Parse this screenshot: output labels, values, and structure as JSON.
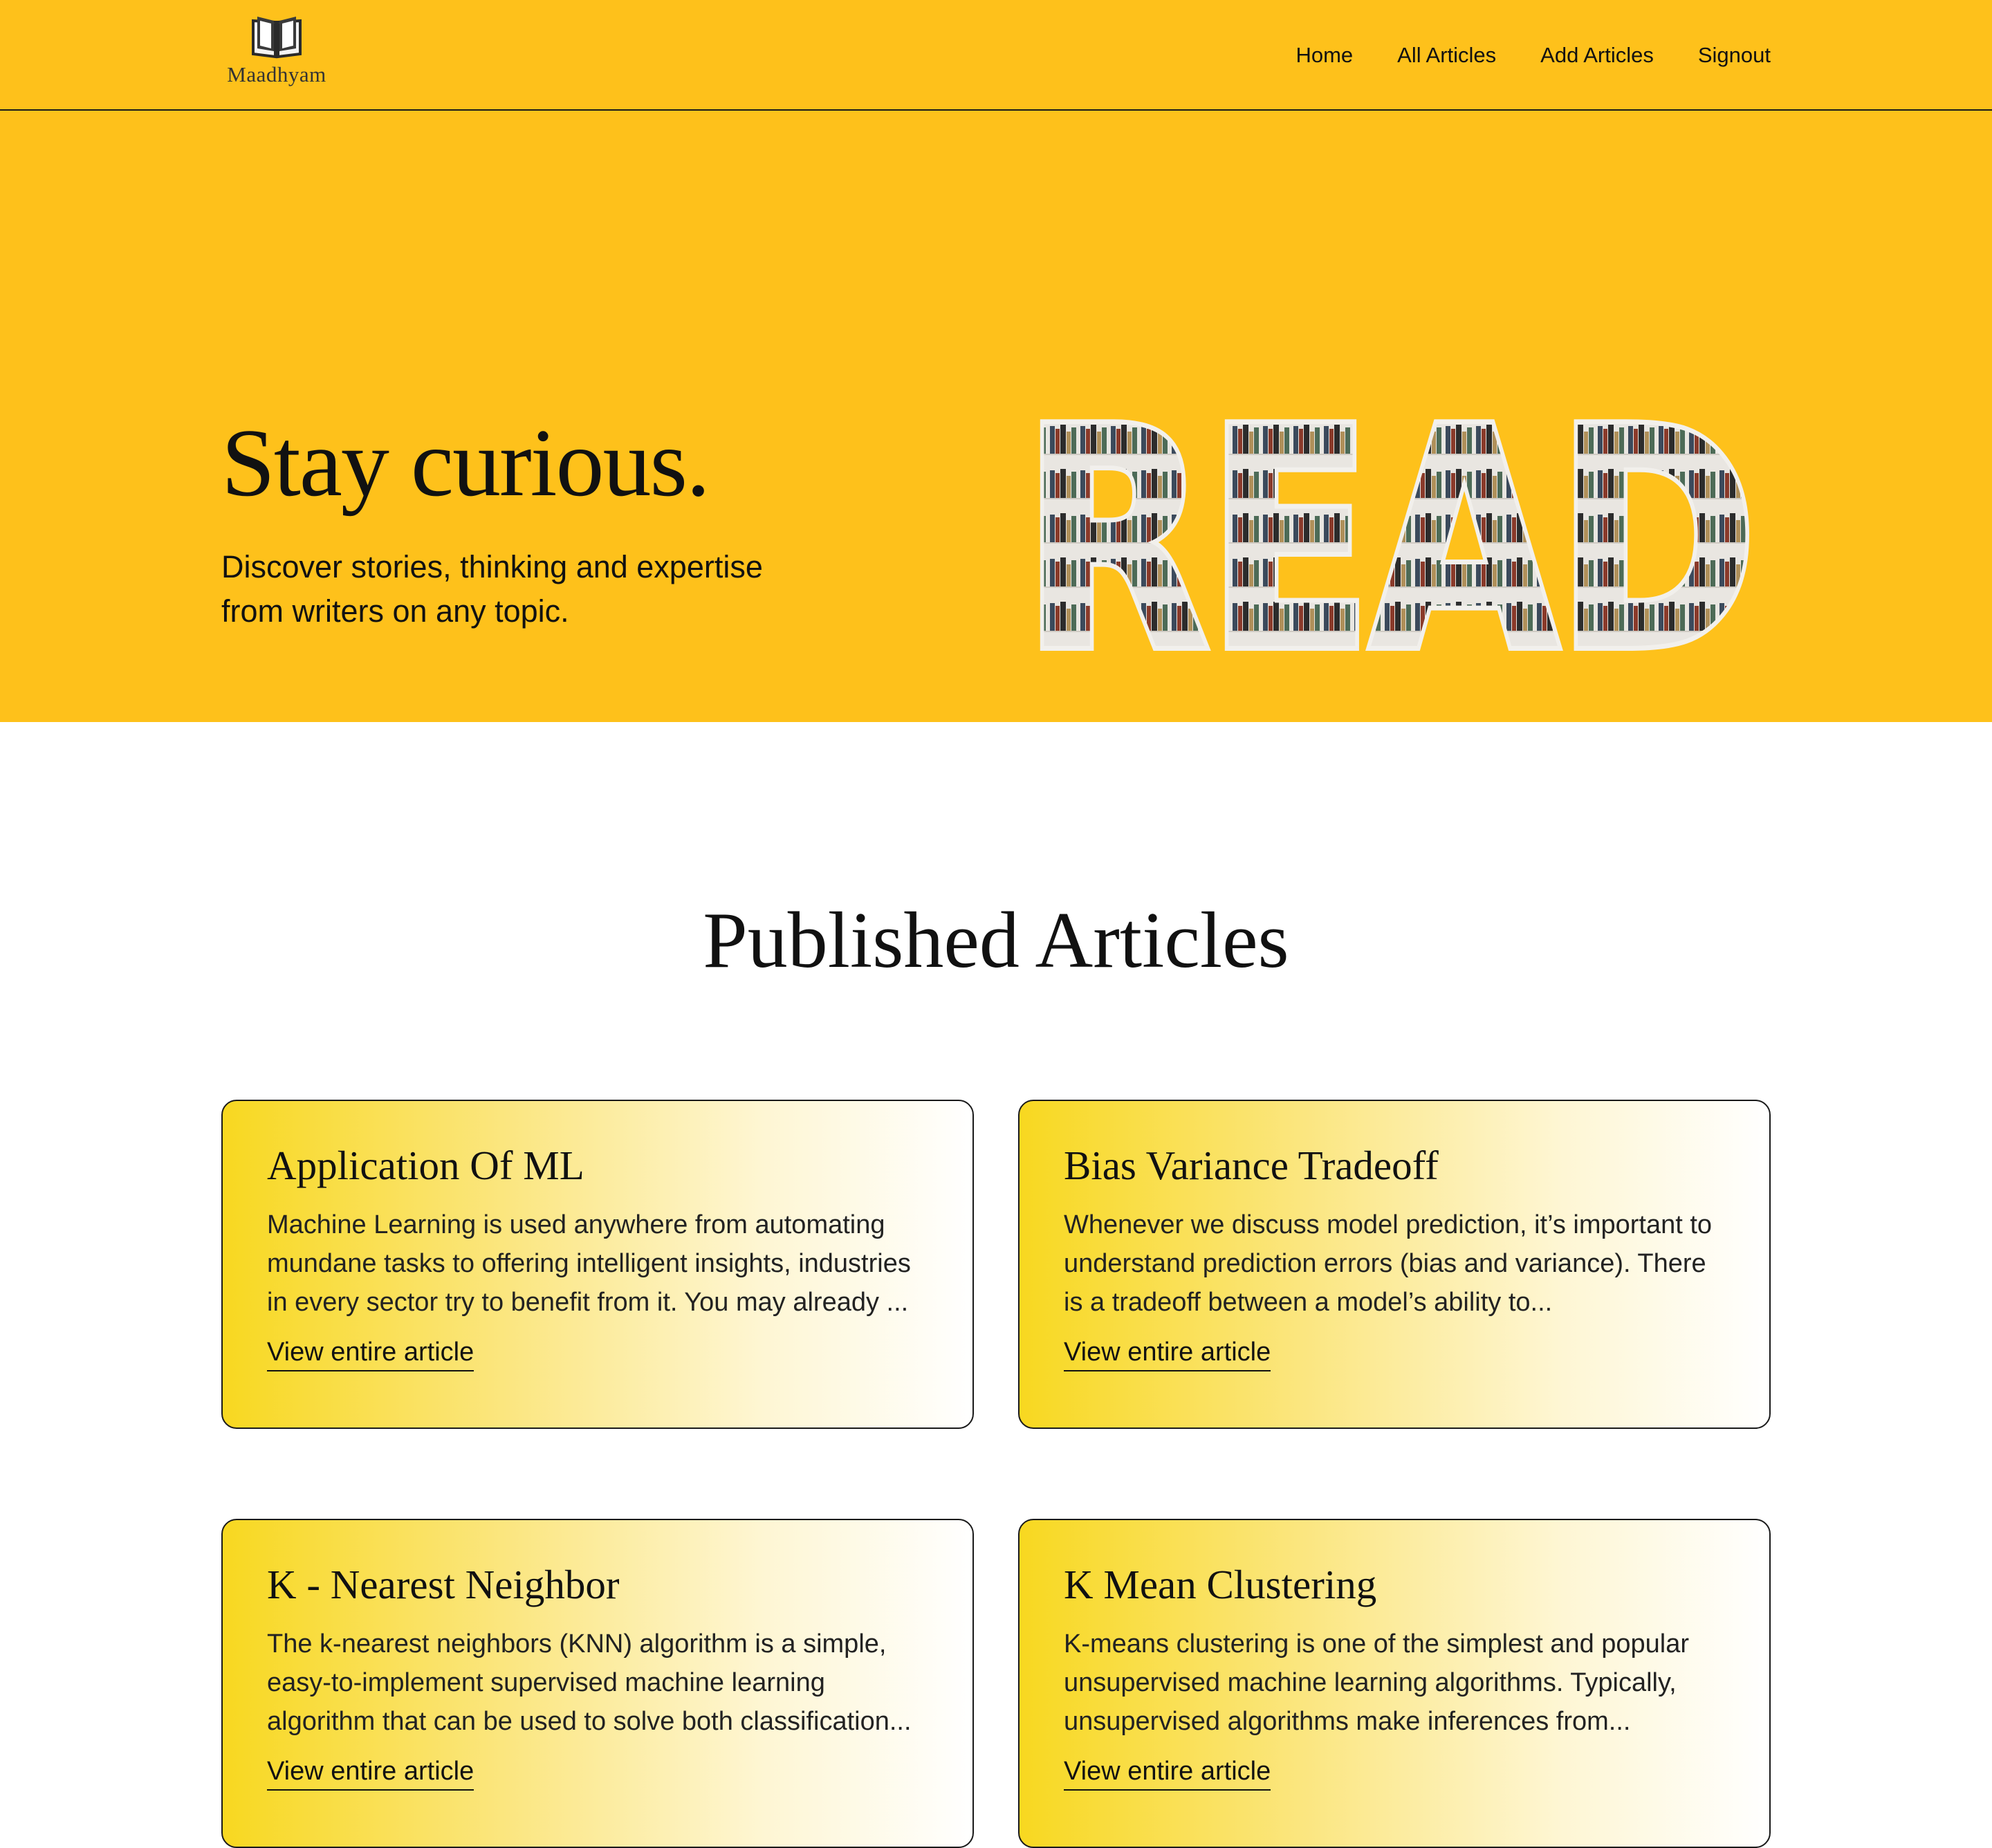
{
  "header": {
    "brand": "Maadhyam",
    "logo_icon": "open-book-icon",
    "nav": [
      {
        "label": "Home"
      },
      {
        "label": "All Articles"
      },
      {
        "label": "Add Articles"
      },
      {
        "label": "Signout"
      }
    ]
  },
  "hero": {
    "title": "Stay curious.",
    "subtitle": "Discover stories, thinking and expertise from writers on any topic.",
    "art": "READ",
    "background": "#fec11b"
  },
  "articles_section": {
    "heading": "Published Articles",
    "link_label": "View entire article",
    "items": [
      {
        "title": "Application Of ML",
        "excerpt": "Machine Learning is used anywhere from automating mundane tasks to offering intelligent insights, industries in every sector try to benefit from it. You may already ..."
      },
      {
        "title": "Bias Variance Tradeoff",
        "excerpt": "Whenever we discuss model prediction, it’s important to understand prediction errors (bias and variance). There is a tradeoff between a model’s ability to..."
      },
      {
        "title": "K - Nearest Neighbor",
        "excerpt": "The k-nearest neighbors (KNN) algorithm is a simple, easy-to-implement supervised machine learning algorithm that can be used to solve both classification..."
      },
      {
        "title": "K Mean Clustering",
        "excerpt": "K-means clustering is one of the simplest and popular unsupervised machine learning algorithms. Typically, unsupervised algorithms make inferences from..."
      }
    ]
  },
  "colors": {
    "accent": "#fec11b",
    "card_gradient_start": "#f8d820",
    "text": "#111111"
  }
}
